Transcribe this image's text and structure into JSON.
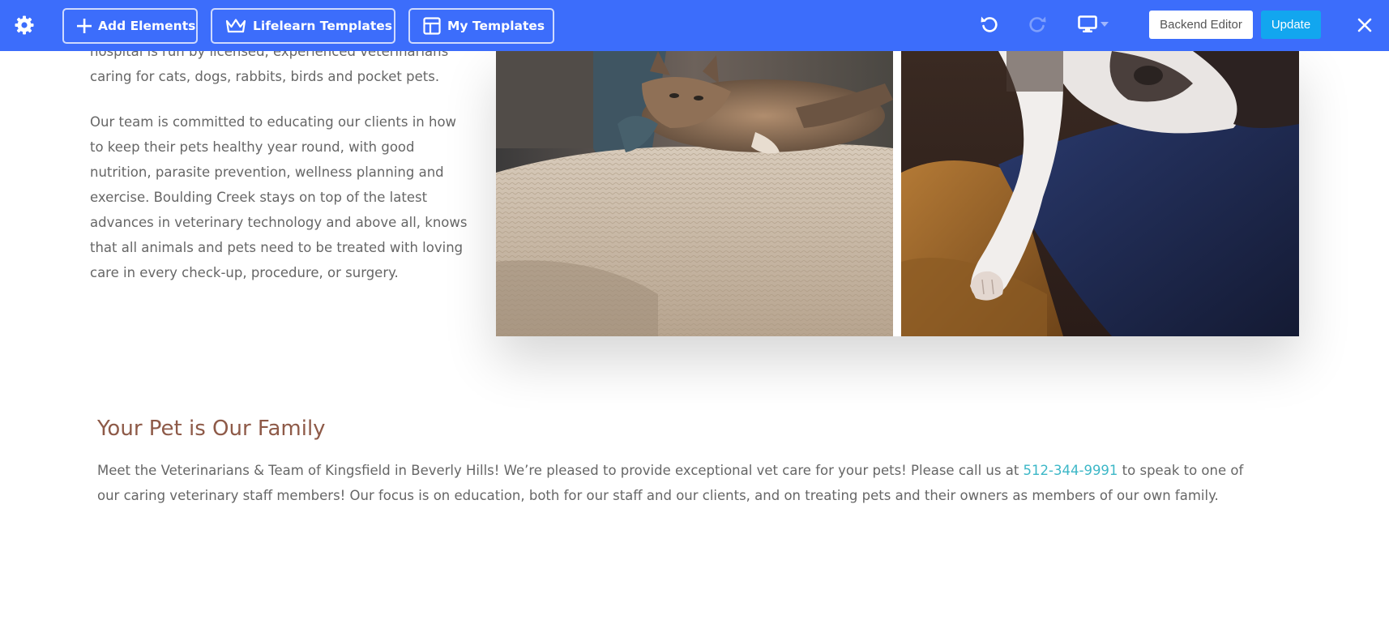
{
  "toolbar": {
    "add_elements": "Add Elements",
    "lifelearn_templates": "Lifelearn Templates",
    "my_templates": "My Templates",
    "backend_editor": "Backend Editor",
    "update": "Update",
    "background_color": "#3c6dfb",
    "update_color": "#12a6ef",
    "icons": [
      "gear-icon",
      "plus-icon",
      "crown-icon",
      "template-layout-icon",
      "undo-icon",
      "redo-icon",
      "desktop-icon",
      "chevron-down-icon",
      "close-icon"
    ]
  },
  "intro": {
    "paragraph1": "hospital is run by licensed, experienced veterinarians caring for cats, dogs, rabbits, birds and pocket pets.",
    "paragraph2": "Our team is committed to educating our clients in how to keep their pets healthy year round, with good nutrition, parasite prevention, wellness planning and exercise. Boulding Creek stays on top of the latest advances in veterinary technology and above all, knows that all animals and pets need to be treated with loving care in every check-up, procedure, or surgery."
  },
  "family": {
    "title": "Your Pet is Our Family",
    "text_before": "Meet the Veterinarians & Team of Kingsfield in Beverly Hills! We’re pleased to provide exceptional vet care for your pets! Please call us at ",
    "phone": "512-344-9991",
    "text_after": " to speak to one of our caring veterinary staff members! Our focus is on education, both for our staff and our clients, and on treating pets and their owners as members of our own family.",
    "title_color": "#8e5a48",
    "link_color": "#3cb7c7"
  }
}
